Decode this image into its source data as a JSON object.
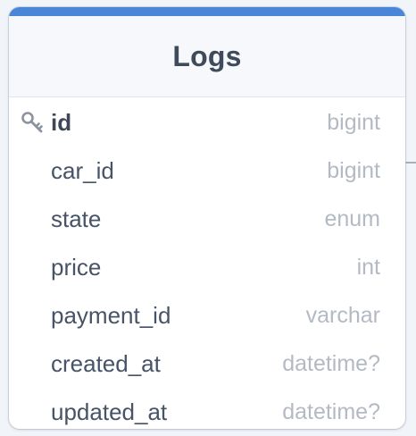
{
  "table": {
    "title": "Logs",
    "accent_color": "#4a86d8",
    "columns": [
      {
        "name": "id",
        "type": "bigint",
        "primary_key": true
      },
      {
        "name": "car_id",
        "type": "bigint",
        "primary_key": false
      },
      {
        "name": "state",
        "type": "enum",
        "primary_key": false
      },
      {
        "name": "price",
        "type": "int",
        "primary_key": false
      },
      {
        "name": "payment_id",
        "type": "varchar",
        "primary_key": false
      },
      {
        "name": "created_at",
        "type": "datetime?",
        "primary_key": false
      },
      {
        "name": "updated_at",
        "type": "datetime?",
        "primary_key": false
      }
    ]
  },
  "icons": {
    "primary_key": "key-icon"
  }
}
